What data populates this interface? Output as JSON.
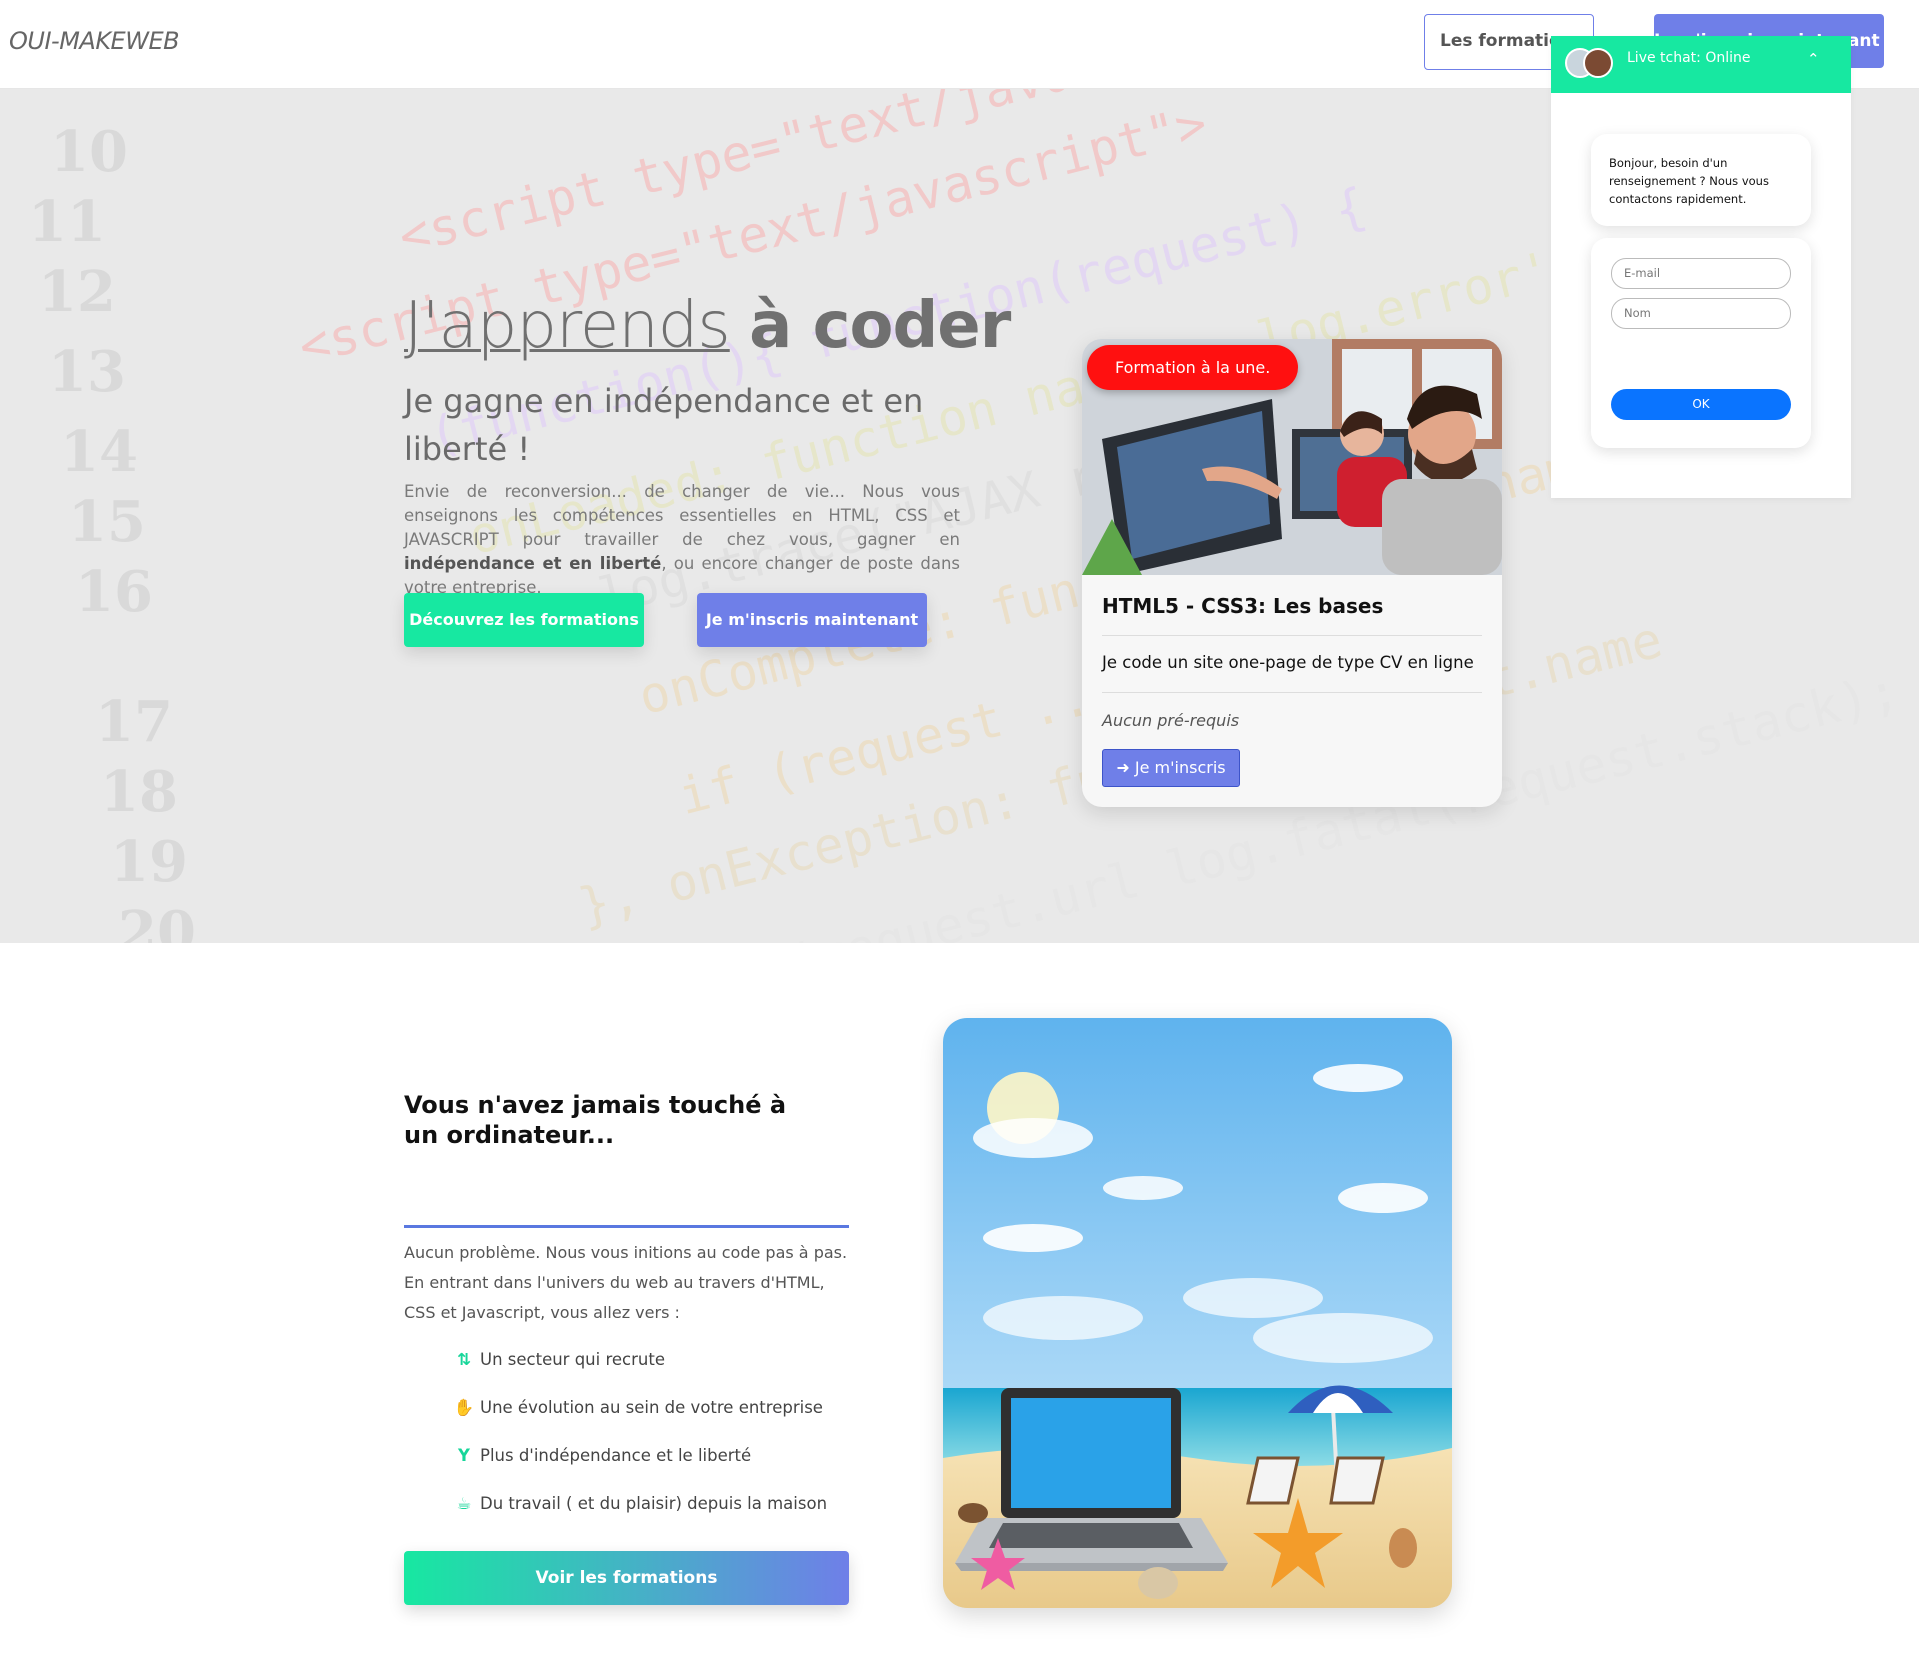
{
  "navbar": {
    "brand": "OUI-MAKEWEB",
    "btn_formations": "Les formations",
    "btn_inscription": "Je m'inscris maintenant"
  },
  "hero": {
    "title_part1": "J'apprends",
    "title_part2": "à coder",
    "subtitle": "Je gagne en indépendance et en liberté !",
    "text_before": "Envie de reconversion... de changer de vie... Nous vous enseignons les compétences essentielles en HTML, CSS et JAVASCRIPT pour travailler de chez vous, gagner en ",
    "text_bold": "indépendance et en liberté",
    "text_after": ", ou encore changer de poste dans votre entreprise.",
    "btn_decouvrez": "Découvrez les formations",
    "btn_inscris": "Je m'inscris maintenant"
  },
  "course_card": {
    "badge": "Formation à la une.",
    "title": "HTML5 - CSS3: Les bases",
    "description": "Je code un site one-page de type CV en ligne",
    "prerequisite": "Aucun pré-requis",
    "button": "Je m'inscris",
    "button_icon": "sign-in-icon"
  },
  "chat": {
    "status": "Live tchat: Online",
    "toggle_icon": "chevron-up-icon",
    "message": "Bonjour, besoin d'un renseignement ? Nous vous contactons rapidement.",
    "email_placeholder": "E-mail",
    "name_placeholder": "Nom",
    "ok_button": "OK"
  },
  "section2": {
    "title": "Vous n'avez jamais touché à un ordinateur...",
    "text": "Aucun problème. Nous vous initions au code pas à pas. En entrant dans l'univers du web au travers d'HTML, CSS et Javascript, vous allez vers :",
    "items": [
      {
        "icon": "sort-amount-up-icon",
        "label": "Un secteur qui recrute"
      },
      {
        "icon": "handshake-icon",
        "label": "Une évolution au sein de votre entreprise"
      },
      {
        "icon": "cocktail-icon",
        "label": "Plus d'indépendance et le liberté"
      },
      {
        "icon": "coffee-icon",
        "label": "Du travail ( et du plaisir) depuis la maison"
      }
    ],
    "button": "Voir les formations"
  },
  "colors": {
    "green": "#17e8a1",
    "violet": "#6f7fe8",
    "red_badge": "#ff1010",
    "chat_ok_blue": "#0a74ff"
  }
}
